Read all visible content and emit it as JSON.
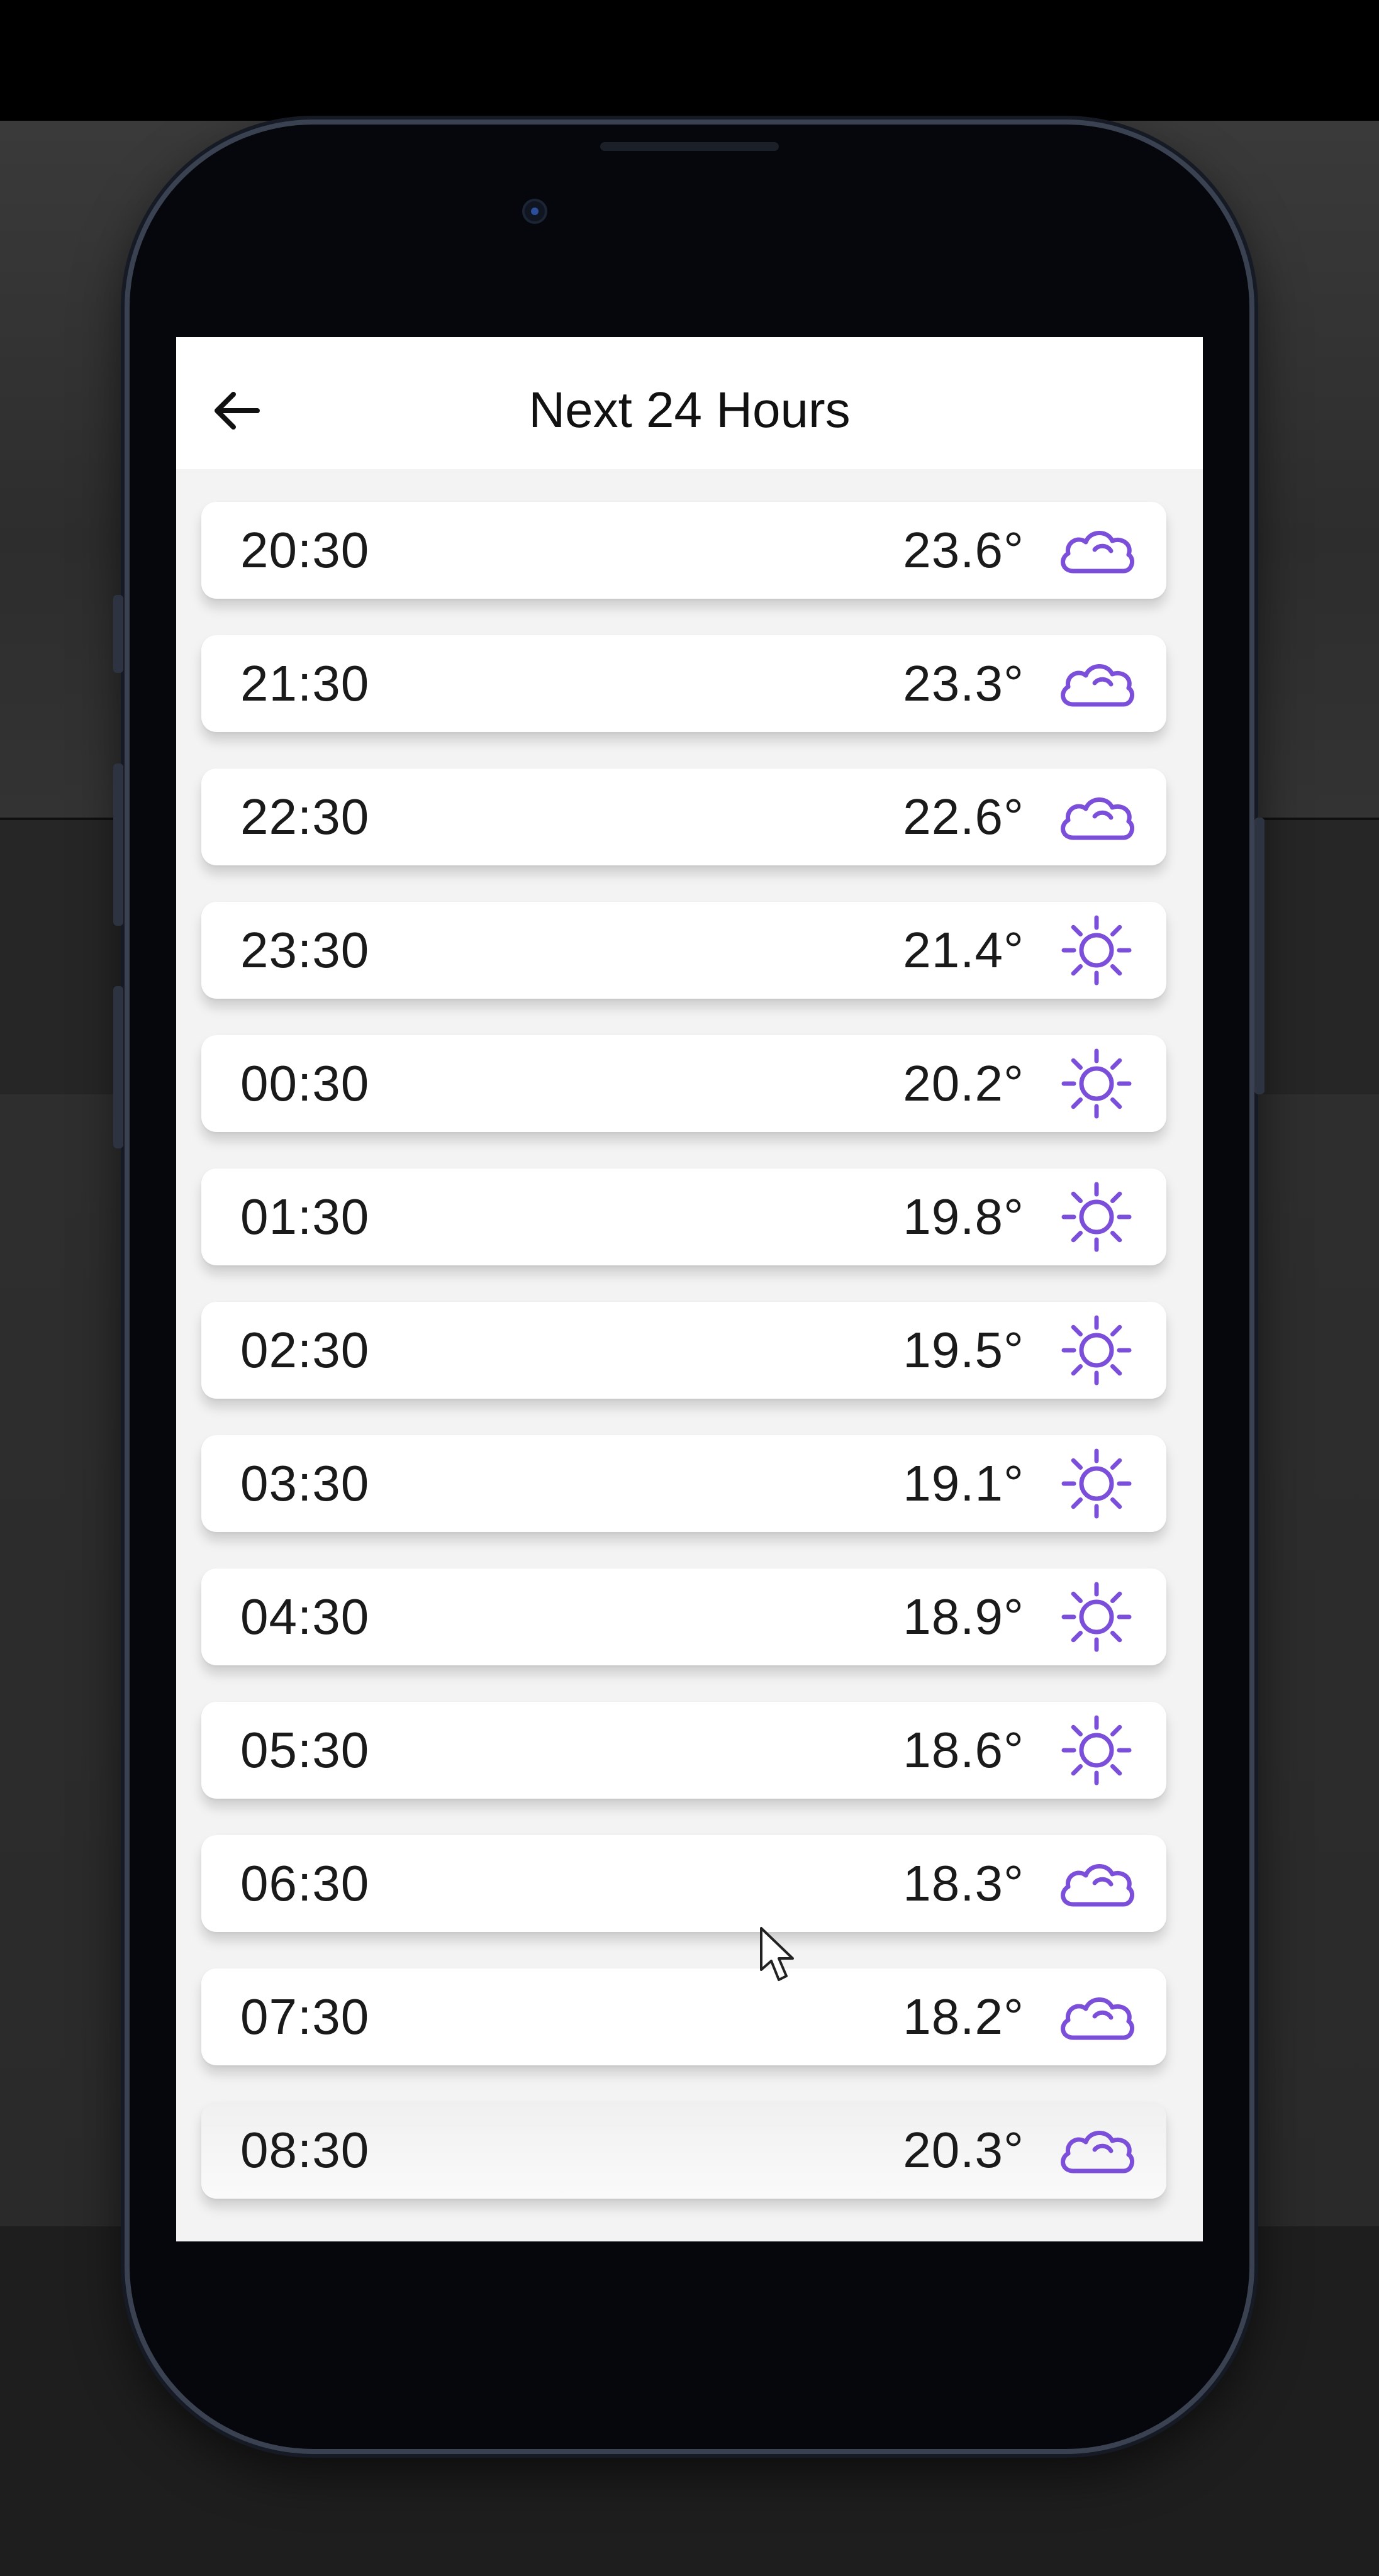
{
  "colors": {
    "accent": "#7b4fd9",
    "text": "#1a1a1a",
    "card": "#ffffff",
    "screen_bg": "#f3f3f3"
  },
  "app_bar": {
    "title": "Next 24 Hours",
    "back_icon": "arrow-left-icon"
  },
  "forecast": [
    {
      "time": "20:30",
      "temp": "23.6°",
      "icon": "cloud"
    },
    {
      "time": "21:30",
      "temp": "23.3°",
      "icon": "cloud"
    },
    {
      "time": "22:30",
      "temp": "22.6°",
      "icon": "cloud"
    },
    {
      "time": "23:30",
      "temp": "21.4°",
      "icon": "sun"
    },
    {
      "time": "00:30",
      "temp": "20.2°",
      "icon": "sun"
    },
    {
      "time": "01:30",
      "temp": "19.8°",
      "icon": "sun"
    },
    {
      "time": "02:30",
      "temp": "19.5°",
      "icon": "sun"
    },
    {
      "time": "03:30",
      "temp": "19.1°",
      "icon": "sun"
    },
    {
      "time": "04:30",
      "temp": "18.9°",
      "icon": "sun"
    },
    {
      "time": "05:30",
      "temp": "18.6°",
      "icon": "sun"
    },
    {
      "time": "06:30",
      "temp": "18.3°",
      "icon": "cloud"
    },
    {
      "time": "07:30",
      "temp": "18.2°",
      "icon": "cloud"
    },
    {
      "time": "08:30",
      "temp": "20.3°",
      "icon": "cloud"
    }
  ]
}
